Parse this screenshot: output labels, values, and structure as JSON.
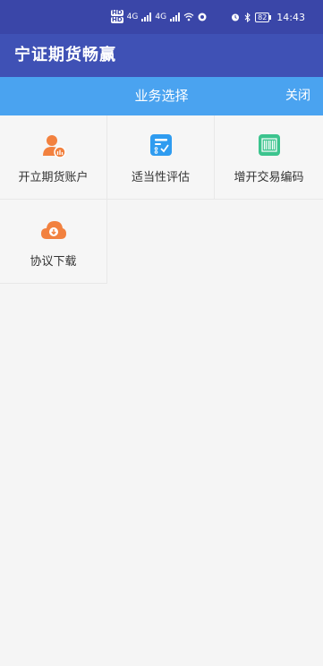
{
  "status_bar": {
    "sim_labels": [
      "HD",
      "HD"
    ],
    "network_labels": [
      "4G",
      "4G"
    ],
    "battery": "82",
    "time": "14:43",
    "icons": [
      "alarm-icon",
      "bluetooth-icon",
      "wifi-icon",
      "signal-icon"
    ]
  },
  "app_bar": {
    "title": "宁证期货畅赢"
  },
  "sub_header": {
    "title": "业务选择",
    "close_label": "关闭"
  },
  "grid": {
    "items": [
      {
        "label": "开立期货账户",
        "icon": "open-account-icon",
        "color": "#f2813f"
      },
      {
        "label": "适当性评估",
        "icon": "assessment-icon",
        "color": "#2f9cf0"
      },
      {
        "label": "增开交易编码",
        "icon": "barcode-icon",
        "color": "#3cc48e"
      },
      {
        "label": "协议下载",
        "icon": "cloud-download-icon",
        "color": "#f2813f"
      }
    ]
  },
  "colors": {
    "status_bar": "#3a46a8",
    "app_bar": "#3f51b5",
    "sub_header": "#4aa3f0",
    "background": "#f5f5f5"
  }
}
